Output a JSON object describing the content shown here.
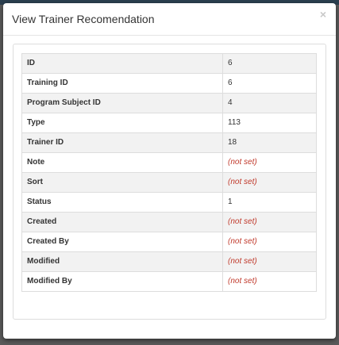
{
  "modal": {
    "title": "View Trainer Recomendation",
    "close_label": "×"
  },
  "rows": [
    {
      "label": "ID",
      "value": "6",
      "not_set": false
    },
    {
      "label": "Training ID",
      "value": "6",
      "not_set": false
    },
    {
      "label": "Program Subject ID",
      "value": "4",
      "not_set": false
    },
    {
      "label": "Type",
      "value": "113",
      "not_set": false
    },
    {
      "label": "Trainer ID",
      "value": "18",
      "not_set": false
    },
    {
      "label": "Note",
      "value": "(not set)",
      "not_set": true
    },
    {
      "label": "Sort",
      "value": "(not set)",
      "not_set": true
    },
    {
      "label": "Status",
      "value": "1",
      "not_set": false
    },
    {
      "label": "Created",
      "value": "(not set)",
      "not_set": true
    },
    {
      "label": "Created By",
      "value": "(not set)",
      "not_set": true
    },
    {
      "label": "Modified",
      "value": "(not set)",
      "not_set": true
    },
    {
      "label": "Modified By",
      "value": "(not set)",
      "not_set": true
    }
  ],
  "colors": {
    "not_set": "#c0392b",
    "odd_row": "#f2f2f2",
    "even_row": "#ffffff",
    "border": "#dddddd"
  }
}
